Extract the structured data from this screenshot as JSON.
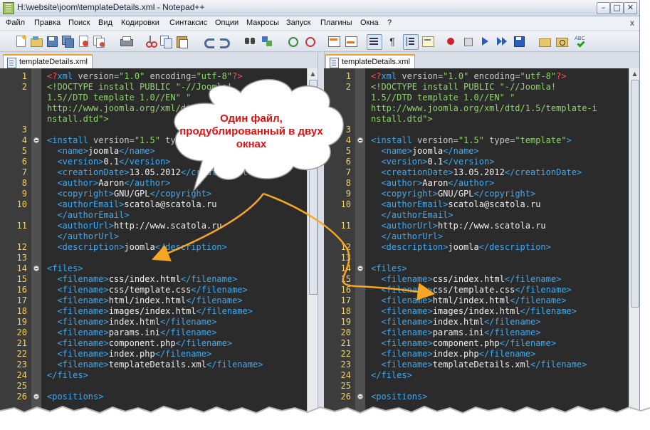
{
  "window": {
    "title": "H:\\website\\joom\\templateDetails.xml - Notepad++",
    "minimize_glyph": "–",
    "maximize_glyph": "□",
    "close_glyph": "✕",
    "close_doc_glyph": "x"
  },
  "menu": {
    "items": [
      "Файл",
      "Правка",
      "Поиск",
      "Вид",
      "Кодировки",
      "Синтаксис",
      "Опции",
      "Макросы",
      "Запуск",
      "Плагины",
      "Окна",
      "?"
    ]
  },
  "toolbar": {
    "icons": [
      "new-file-icon",
      "open-file-icon",
      "save-icon",
      "save-all-icon",
      "close-icon",
      "close-all-icon",
      "print-icon",
      "cut-icon",
      "copy-icon",
      "paste-icon",
      "undo-icon",
      "redo-icon",
      "find-icon",
      "replace-icon",
      "zoom-in-icon",
      "zoom-out-icon",
      "sync-vertical-icon",
      "sync-horizontal-icon",
      "word-wrap-icon",
      "show-all-chars-icon",
      "indent-guide-icon",
      "user-lang-icon",
      "record-macro-icon",
      "stop-macro-icon",
      "play-macro-icon",
      "run-macro-multiple-icon",
      "save-macro-icon",
      "open-folder-icon",
      "file-browser-icon",
      "spell-check-icon"
    ]
  },
  "tabs": {
    "left": "templateDetails.xml",
    "right": "templateDetails.xml"
  },
  "editor": {
    "left_lines": [
      {
        "n": "1",
        "tokens": [
          [
            "pi",
            "<?"
          ],
          [
            "kw",
            "xml"
          ],
          [
            "attr",
            " version="
          ],
          [
            "val",
            "\"1.0\""
          ],
          [
            "attr",
            " encoding="
          ],
          [
            "val",
            "\"utf-8\""
          ],
          [
            "pi",
            "?>"
          ]
        ]
      },
      {
        "n": "2",
        "tokens": [
          [
            "dt",
            "<!DOCTYPE install PUBLIC \"-//Joomla!"
          ]
        ]
      },
      {
        "n": "",
        "tokens": [
          [
            "dt",
            "1.5//DTD template 1.0//EN\" \""
          ]
        ]
      },
      {
        "n": "",
        "tokens": [
          [
            "dt",
            "http://www.joomla.org/xml/dtd/1.5/template-i"
          ]
        ]
      },
      {
        "n": "",
        "tokens": [
          [
            "dt",
            "nstall.dtd\">"
          ]
        ]
      },
      {
        "n": "3",
        "tokens": []
      },
      {
        "n": "4",
        "fold": true,
        "tokens": [
          [
            "tag",
            "<install"
          ],
          [
            "attr",
            " version="
          ],
          [
            "val",
            "\"1.5\""
          ],
          [
            "attr",
            " type="
          ],
          [
            "val",
            "\"template\""
          ],
          [
            "tag",
            ">"
          ]
        ]
      },
      {
        "n": "5",
        "tokens": [
          [
            "txt",
            "  "
          ],
          [
            "tag",
            "<name>"
          ],
          [
            "txt",
            "joomla"
          ],
          [
            "tag",
            "</name>"
          ]
        ]
      },
      {
        "n": "6",
        "tokens": [
          [
            "txt",
            "  "
          ],
          [
            "tag",
            "<version>"
          ],
          [
            "txt",
            "0.1"
          ],
          [
            "tag",
            "</version>"
          ]
        ]
      },
      {
        "n": "7",
        "tokens": [
          [
            "txt",
            "  "
          ],
          [
            "tag",
            "<creationDate>"
          ],
          [
            "txt",
            "13.05.2012"
          ],
          [
            "tag",
            "</creationDate>"
          ]
        ]
      },
      {
        "n": "8",
        "tokens": [
          [
            "txt",
            "  "
          ],
          [
            "tag",
            "<author>"
          ],
          [
            "txt",
            "Aaron"
          ],
          [
            "tag",
            "</author>"
          ]
        ]
      },
      {
        "n": "9",
        "tokens": [
          [
            "txt",
            "  "
          ],
          [
            "tag",
            "<copyright>"
          ],
          [
            "txt",
            "GNU/GPL"
          ],
          [
            "tag",
            "</copyright>"
          ]
        ]
      },
      {
        "n": "10",
        "tokens": [
          [
            "txt",
            "  "
          ],
          [
            "tag",
            "<authorEmail>"
          ],
          [
            "txt",
            "scatola@scatola.ru"
          ]
        ]
      },
      {
        "n": "",
        "tokens": [
          [
            "txt",
            "  "
          ],
          [
            "tag",
            "</authorEmail>"
          ]
        ]
      },
      {
        "n": "11",
        "tokens": [
          [
            "txt",
            "  "
          ],
          [
            "tag",
            "<authorUrl>"
          ],
          [
            "txt",
            "http://www.scatola.ru"
          ]
        ]
      },
      {
        "n": "",
        "tokens": [
          [
            "txt",
            "  "
          ],
          [
            "tag",
            "</authorUrl>"
          ]
        ]
      },
      {
        "n": "12",
        "tokens": [
          [
            "txt",
            "  "
          ],
          [
            "tag",
            "<description>"
          ],
          [
            "txt",
            "joomla"
          ],
          [
            "tag",
            "</description>"
          ]
        ]
      },
      {
        "n": "13",
        "tokens": []
      },
      {
        "n": "14",
        "fold": true,
        "tokens": [
          [
            "tag",
            "<files>"
          ]
        ]
      },
      {
        "n": "15",
        "tokens": [
          [
            "txt",
            "  "
          ],
          [
            "tag",
            "<filename>"
          ],
          [
            "txt",
            "css/index.html"
          ],
          [
            "tag",
            "</filename>"
          ]
        ]
      },
      {
        "n": "16",
        "tokens": [
          [
            "txt",
            "  "
          ],
          [
            "tag",
            "<filename>"
          ],
          [
            "txt",
            "css/template.css"
          ],
          [
            "tag",
            "</filename>"
          ]
        ]
      },
      {
        "n": "17",
        "tokens": [
          [
            "txt",
            "  "
          ],
          [
            "tag",
            "<filename>"
          ],
          [
            "txt",
            "html/index.html"
          ],
          [
            "tag",
            "</filename>"
          ]
        ]
      },
      {
        "n": "18",
        "tokens": [
          [
            "txt",
            "  "
          ],
          [
            "tag",
            "<filename>"
          ],
          [
            "txt",
            "images/index.html"
          ],
          [
            "tag",
            "</filename>"
          ]
        ]
      },
      {
        "n": "19",
        "tokens": [
          [
            "txt",
            "  "
          ],
          [
            "tag",
            "<filename>"
          ],
          [
            "txt",
            "index.html"
          ],
          [
            "tag",
            "</filename>"
          ]
        ]
      },
      {
        "n": "20",
        "tokens": [
          [
            "txt",
            "  "
          ],
          [
            "tag",
            "<filename>"
          ],
          [
            "txt",
            "params.ini"
          ],
          [
            "tag",
            "</filename>"
          ]
        ]
      },
      {
        "n": "21",
        "tokens": [
          [
            "txt",
            "  "
          ],
          [
            "tag",
            "<filename>"
          ],
          [
            "txt",
            "component.php"
          ],
          [
            "tag",
            "</filename>"
          ]
        ]
      },
      {
        "n": "22",
        "tokens": [
          [
            "txt",
            "  "
          ],
          [
            "tag",
            "<filename>"
          ],
          [
            "txt",
            "index.php"
          ],
          [
            "tag",
            "</filename>"
          ]
        ]
      },
      {
        "n": "23",
        "tokens": [
          [
            "txt",
            "  "
          ],
          [
            "tag",
            "<filename>"
          ],
          [
            "txt",
            "templateDetails.xml"
          ],
          [
            "tag",
            "</filename>"
          ]
        ]
      },
      {
        "n": "24",
        "tokens": [
          [
            "tag",
            "</files>"
          ]
        ]
      },
      {
        "n": "25",
        "tokens": []
      },
      {
        "n": "26",
        "fold": true,
        "tokens": [
          [
            "tag",
            "<positions>"
          ]
        ]
      }
    ],
    "right_lines": [
      {
        "n": "1",
        "tokens": [
          [
            "pi",
            "<?"
          ],
          [
            "kw",
            "xml"
          ],
          [
            "attr",
            " version="
          ],
          [
            "val",
            "\"1.0\""
          ],
          [
            "attr",
            " encoding="
          ],
          [
            "val",
            "\"utf-8\""
          ],
          [
            "pi",
            "?>"
          ]
        ]
      },
      {
        "n": "2",
        "tokens": [
          [
            "dt",
            "<!DOCTYPE install PUBLIC \"-//Joomla!"
          ]
        ]
      },
      {
        "n": "",
        "tokens": [
          [
            "dt",
            "1.5//DTD template 1.0//EN\" \""
          ]
        ]
      },
      {
        "n": "",
        "tokens": [
          [
            "dt",
            "http://www.joomla.org/xml/dtd/1.5/template-i"
          ]
        ]
      },
      {
        "n": "",
        "tokens": [
          [
            "dt",
            "nstall.dtd\">"
          ]
        ]
      },
      {
        "n": "3",
        "tokens": []
      },
      {
        "n": "4",
        "fold": true,
        "tokens": [
          [
            "tag",
            "<install"
          ],
          [
            "attr",
            " version="
          ],
          [
            "val",
            "\"1.5\""
          ],
          [
            "attr",
            " type="
          ],
          [
            "val",
            "\"template\""
          ],
          [
            "tag",
            ">"
          ]
        ]
      },
      {
        "n": "5",
        "tokens": [
          [
            "txt",
            "  "
          ],
          [
            "tag",
            "<name>"
          ],
          [
            "txt",
            "joomla"
          ],
          [
            "tag",
            "</name>"
          ]
        ]
      },
      {
        "n": "6",
        "tokens": [
          [
            "txt",
            "  "
          ],
          [
            "tag",
            "<version>"
          ],
          [
            "txt",
            "0.1"
          ],
          [
            "tag",
            "</version>"
          ]
        ]
      },
      {
        "n": "7",
        "tokens": [
          [
            "txt",
            "  "
          ],
          [
            "tag",
            "<creationDate>"
          ],
          [
            "txt",
            "13.05.2012"
          ],
          [
            "tag",
            "</creationDate>"
          ]
        ]
      },
      {
        "n": "8",
        "tokens": [
          [
            "txt",
            "  "
          ],
          [
            "tag",
            "<author>"
          ],
          [
            "txt",
            "Aaron"
          ],
          [
            "tag",
            "</author>"
          ]
        ]
      },
      {
        "n": "9",
        "tokens": [
          [
            "txt",
            "  "
          ],
          [
            "tag",
            "<copyright>"
          ],
          [
            "txt",
            "GNU/GPL"
          ],
          [
            "tag",
            "</copyright>"
          ]
        ]
      },
      {
        "n": "10",
        "tokens": [
          [
            "txt",
            "  "
          ],
          [
            "tag",
            "<authorEmail>"
          ],
          [
            "txt",
            "scatola@scatola.ru"
          ]
        ]
      },
      {
        "n": "",
        "tokens": [
          [
            "txt",
            "  "
          ],
          [
            "tag",
            "</authorEmail>"
          ]
        ]
      },
      {
        "n": "11",
        "tokens": [
          [
            "txt",
            "  "
          ],
          [
            "tag",
            "<authorUrl>"
          ],
          [
            "txt",
            "http://www.scatola.ru"
          ]
        ]
      },
      {
        "n": "",
        "tokens": [
          [
            "txt",
            "  "
          ],
          [
            "tag",
            "</authorUrl>"
          ]
        ]
      },
      {
        "n": "12",
        "tokens": [
          [
            "txt",
            "  "
          ],
          [
            "tag",
            "<description>"
          ],
          [
            "txt",
            "joomla"
          ],
          [
            "tag",
            "</description>"
          ]
        ]
      },
      {
        "n": "13",
        "tokens": []
      },
      {
        "n": "14",
        "fold": true,
        "tokens": [
          [
            "tag",
            "<files>"
          ]
        ]
      },
      {
        "n": "15",
        "tokens": [
          [
            "txt",
            "  "
          ],
          [
            "tag",
            "<filename>"
          ],
          [
            "txt",
            "css/index.html"
          ],
          [
            "tag",
            "</filename>"
          ]
        ]
      },
      {
        "n": "16",
        "tokens": [
          [
            "txt",
            "  "
          ],
          [
            "tag",
            "<filename>"
          ],
          [
            "txt",
            "css/template.css"
          ],
          [
            "tag",
            "</filename>"
          ]
        ]
      },
      {
        "n": "17",
        "tokens": [
          [
            "txt",
            "  "
          ],
          [
            "tag",
            "<filename>"
          ],
          [
            "txt",
            "html/index.html"
          ],
          [
            "tag",
            "</filename>"
          ]
        ]
      },
      {
        "n": "18",
        "tokens": [
          [
            "txt",
            "  "
          ],
          [
            "tag",
            "<filename>"
          ],
          [
            "txt",
            "images/index.html"
          ],
          [
            "tag",
            "</filename>"
          ]
        ]
      },
      {
        "n": "19",
        "tokens": [
          [
            "txt",
            "  "
          ],
          [
            "tag",
            "<filename>"
          ],
          [
            "txt",
            "index.html"
          ],
          [
            "tag",
            "</filename>"
          ]
        ]
      },
      {
        "n": "20",
        "tokens": [
          [
            "txt",
            "  "
          ],
          [
            "tag",
            "<filename>"
          ],
          [
            "txt",
            "params.ini"
          ],
          [
            "tag",
            "</filename>"
          ]
        ]
      },
      {
        "n": "21",
        "tokens": [
          [
            "txt",
            "  "
          ],
          [
            "tag",
            "<filename>"
          ],
          [
            "txt",
            "component.php"
          ],
          [
            "tag",
            "</filename>"
          ]
        ]
      },
      {
        "n": "22",
        "tokens": [
          [
            "txt",
            "  "
          ],
          [
            "tag",
            "<filename>"
          ],
          [
            "txt",
            "index.php"
          ],
          [
            "tag",
            "</filename>"
          ]
        ]
      },
      {
        "n": "23",
        "tokens": [
          [
            "txt",
            "  "
          ],
          [
            "tag",
            "<filename>"
          ],
          [
            "txt",
            "templateDetails.xml"
          ],
          [
            "tag",
            "</filename>"
          ]
        ]
      },
      {
        "n": "24",
        "tokens": [
          [
            "tag",
            "</files>"
          ]
        ]
      },
      {
        "n": "25",
        "tokens": []
      },
      {
        "n": "26",
        "fold": true,
        "tokens": [
          [
            "tag",
            "<positions>"
          ]
        ]
      }
    ]
  },
  "callout": {
    "text": "Один файл, продублированный в двух окнах"
  },
  "colors": {
    "editor_bg": "#2b2b2b",
    "tag": "#41a9ee",
    "text": "#f0f0f0",
    "value": "#8fd46a",
    "processing_instruction": "#ff5050",
    "line_number": "#f2d26a",
    "callout_text": "#e01010",
    "arrow": "#f5a623"
  }
}
